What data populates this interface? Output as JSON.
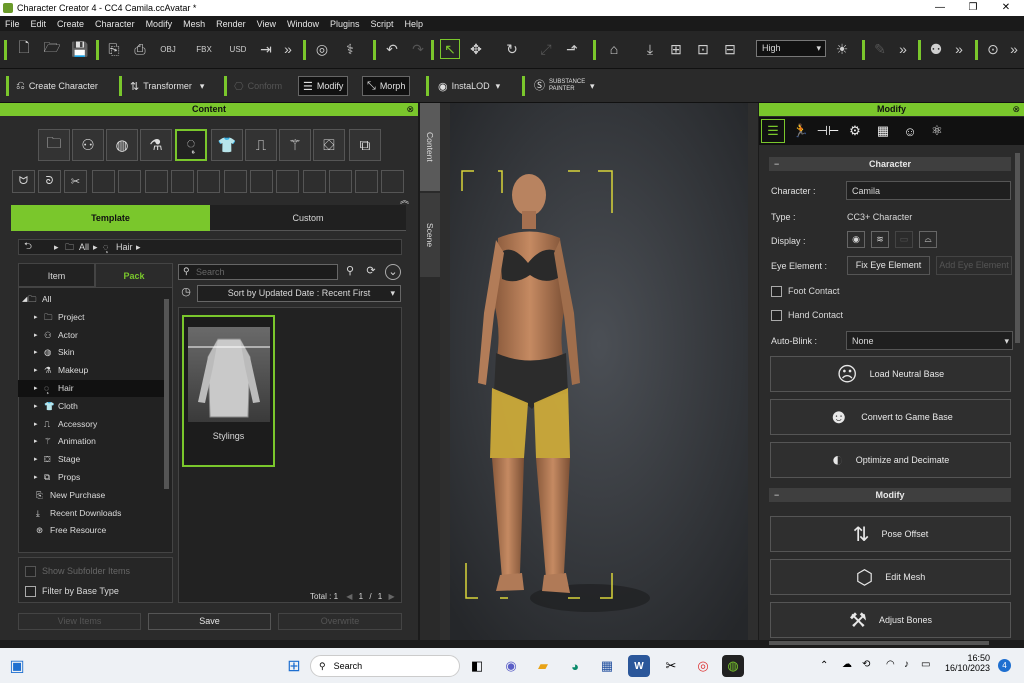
{
  "window": {
    "title": "Character Creator 4 - CC4 Camila.ccAvatar *",
    "controls": [
      "—",
      "❐",
      "✕"
    ]
  },
  "menu": [
    "File",
    "Edit",
    "Create",
    "Character",
    "Modify",
    "Mesh",
    "Render",
    "View",
    "Window",
    "Plugins",
    "Script",
    "Help"
  ],
  "toolbar": {
    "quality": "High",
    "more": "»"
  },
  "toolbar2": {
    "create_character": "Create Character",
    "transformer": "Transformer",
    "conform": "Conform",
    "modify": "Modify",
    "morph": "Morph",
    "instalod": "InstaLOD",
    "substance": "SUBSTANCE PAINTER"
  },
  "content": {
    "title": "Content",
    "tabs": [
      "Template",
      "Custom"
    ],
    "breadcrumb": [
      "All",
      "Hair"
    ],
    "subtabs": [
      "Item",
      "Pack"
    ],
    "search_placeholder": "Search",
    "sort": "Sort by Updated Date : Recent First",
    "tree": [
      {
        "label": "All",
        "level": 0
      },
      {
        "label": "Project",
        "level": 1
      },
      {
        "label": "Actor",
        "level": 1
      },
      {
        "label": "Skin",
        "level": 1
      },
      {
        "label": "Makeup",
        "level": 1
      },
      {
        "label": "Hair",
        "level": 1,
        "selected": true
      },
      {
        "label": "Cloth",
        "level": 1
      },
      {
        "label": "Accessory",
        "level": 1
      },
      {
        "label": "Animation",
        "level": 1
      },
      {
        "label": "Stage",
        "level": 1
      },
      {
        "label": "Props",
        "level": 1
      },
      {
        "label": "New Purchase",
        "level": 0
      },
      {
        "label": "Recent Downloads",
        "level": 0
      },
      {
        "label": "Free Resource",
        "level": 0
      }
    ],
    "item": {
      "label": "Stylings"
    },
    "show_subfolder": "Show Subfolder Items",
    "filter": "Filter by Base Type",
    "total": "Total : 1",
    "page": "1",
    "pages": "1",
    "buttons": {
      "view": "View Items",
      "save": "Save",
      "overwrite": "Overwrite"
    }
  },
  "side_tabs": [
    "Content",
    "Scene"
  ],
  "modify": {
    "title": "Modify",
    "section_character": "Character",
    "character_label": "Character :",
    "character_value": "Camila",
    "type_label": "Type :",
    "type_value": "CC3+ Character",
    "display_label": "Display :",
    "eye_label": "Eye Element :",
    "fix_eye": "Fix Eye Element",
    "add_eye": "Add Eye Element",
    "foot_contact": "Foot Contact",
    "hand_contact": "Hand Contact",
    "autoblink_label": "Auto-Blink :",
    "autoblink_value": "None",
    "load_neutral": "Load Neutral Base",
    "convert_game": "Convert to Game Base",
    "optimize": "Optimize and Decimate",
    "section_modify": "Modify",
    "pose_offset": "Pose Offset",
    "edit_mesh": "Edit Mesh",
    "adjust_bones": "Adjust Bones"
  },
  "taskbar": {
    "search": "Search",
    "time": "16:50",
    "date": "16/10/2023",
    "badge": "4"
  }
}
